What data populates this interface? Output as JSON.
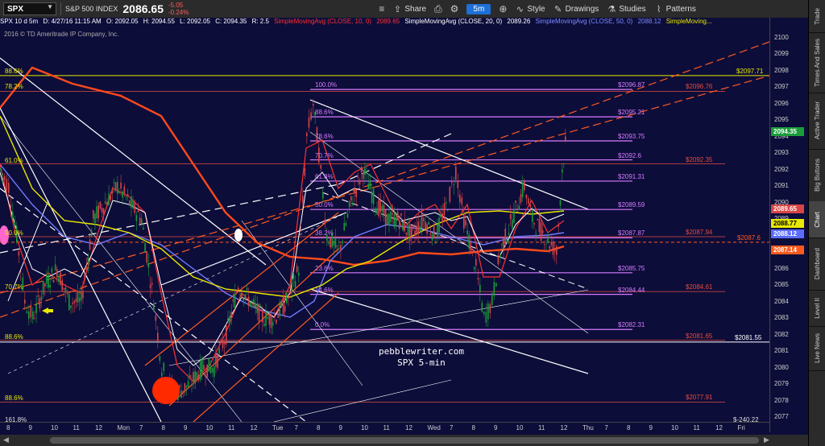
{
  "toolbar": {
    "symbol": "SPX",
    "period": "SPX 10 d 5m",
    "date": "D: 4/27/16 11:15 AM",
    "index_name": "S&P 500 INDEX",
    "price": "2086.65",
    "change_abs": "-5.05",
    "change_pct": "-0.24%",
    "share_label": "Share",
    "timeframe": "5m",
    "style_label": "Style",
    "drawings_label": "Drawings",
    "studies_label": "Studies",
    "patterns_label": "Patterns"
  },
  "ohlc": {
    "o": "O: 2092.05",
    "h": "H: 2094.55",
    "l": "L: 2092.05",
    "c": "C: 2094.35",
    "r": "R: 2.5"
  },
  "studies": {
    "s1": "SimpleMovingAvg (CLOSE, 10, 0)",
    "s1v": "2089.65",
    "s2": "SimpleMovingAvg (CLOSE, 20, 0)",
    "s2v": "2089.26",
    "s3": "SimpleMovingAvg (CLOSE, 50, 0)",
    "s3v": "2088.12",
    "s4": "SimpleMoving..."
  },
  "copyright": "2016 © TD Ameritrade IP Company, Inc.",
  "price_axis": [
    "2100",
    "2099",
    "2098",
    "2097",
    "2096",
    "2095",
    "2094",
    "2093",
    "2092",
    "2091",
    "2090",
    "2089",
    "2088",
    "2087",
    "2086",
    "2085",
    "2084",
    "2083",
    "2082",
    "2081",
    "2080",
    "2079",
    "2078",
    "2077"
  ],
  "price_tags": [
    {
      "v": "2094.35",
      "bg": "#1a9c3a",
      "fg": "#ffffff"
    },
    {
      "v": "2089.65",
      "bg": "#d84545",
      "fg": "#ffffff"
    },
    {
      "v": "2088.77",
      "bg": "#e8e800",
      "fg": "#000000"
    },
    {
      "v": "2088.12",
      "bg": "#5b6cff",
      "fg": "#ffffff"
    },
    {
      "v": "2087.14",
      "bg": "#ff5a1e",
      "fg": "#ffffff"
    }
  ],
  "time_axis": [
    "8",
    "9",
    "10",
    "11",
    "12",
    "Mon",
    "7",
    "8",
    "9",
    "10",
    "11",
    "12",
    "Tue",
    "7",
    "8",
    "9",
    "10",
    "11",
    "12",
    "Wed",
    "7",
    "8",
    "9",
    "10",
    "11",
    "12",
    "Thu",
    "7",
    "8",
    "9",
    "10",
    "11",
    "12",
    "Fri"
  ],
  "fib_levels": [
    {
      "label": "100.0%",
      "value": "$2096.87"
    },
    {
      "label": "88.6%",
      "value": "$2095.21"
    },
    {
      "label": "78.6%",
      "value": "$2093.75"
    },
    {
      "label": "70.7%",
      "value": "$2092.6"
    },
    {
      "label": "61.8%",
      "value": "$2091.31"
    },
    {
      "label": "50.0%",
      "value": "$2089.59"
    },
    {
      "label": "38.2%",
      "value": "$2087.87"
    },
    {
      "label": "23.6%",
      "value": "$2085.75"
    },
    {
      "label": "14.6%",
      "value": "$2084.44"
    },
    {
      "label": "0.0%",
      "value": "$2082.31"
    }
  ],
  "fib2_values": [
    "$2096.76",
    "$2092.35",
    "$2087.94",
    "$2084.61",
    "$2081.65",
    "$2077.91"
  ],
  "left_fib_labels": [
    "88.6%",
    "78.2%",
    "61.0%",
    "50.0%",
    "70.7%",
    "88.6%",
    "88.6%",
    "161.8%"
  ],
  "side_values": {
    "yellow": "$2097.71",
    "orange": "$2087.6",
    "white": "$2081.55",
    "bottom": "$-240.22"
  },
  "watermark": {
    "line1": "pebblewriter.com",
    "line2": "SPX 5-min"
  },
  "right_tabs": [
    "Trade",
    "Times And Sales",
    "Active Trader",
    "Big Buttons",
    "Chart",
    "Dashboard",
    "Level II",
    "Live News"
  ],
  "colors": {
    "background": "#0d0d3a",
    "fib_magenta": "#d77bff",
    "fib_red": "#e74c3c",
    "yellow": "#e8e800",
    "up": "#1a9c3a",
    "down": "#d84545"
  }
}
